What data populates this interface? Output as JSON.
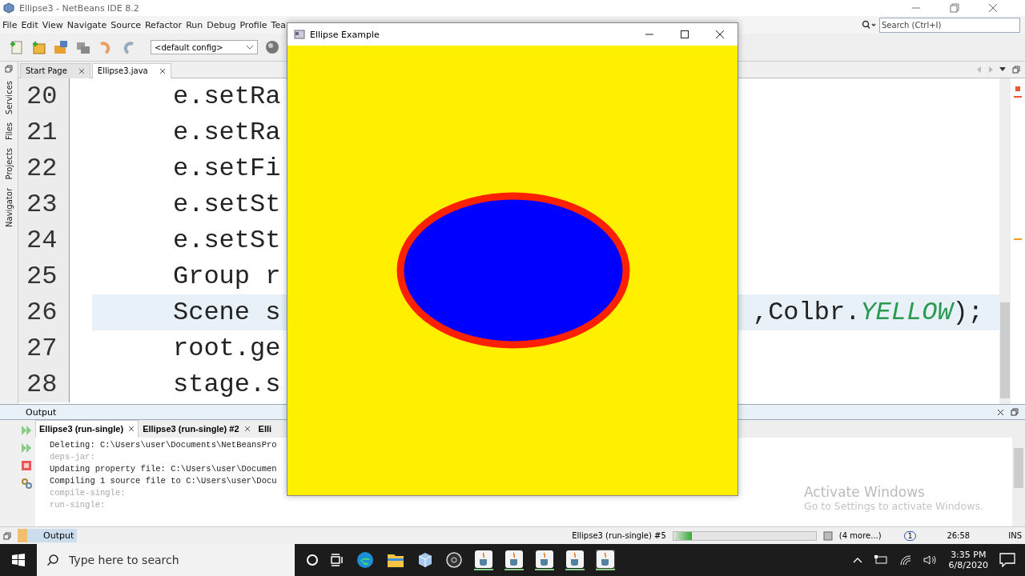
{
  "ide": {
    "title": "Ellipse3 - NetBeans IDE 8.2",
    "menu": [
      "File",
      "Edit",
      "View",
      "Navigate",
      "Source",
      "Refactor",
      "Run",
      "Debug",
      "Profile",
      "Tea"
    ],
    "config": "<default config>",
    "search": {
      "placeholder": "Search (Ctrl+I)"
    }
  },
  "side_tabs": [
    "Services",
    "Files",
    "Projects",
    "Navigator"
  ],
  "editor_tabs": [
    {
      "label": "Start Page",
      "selected": false
    },
    {
      "label": "Ellipse3.java",
      "selected": true
    }
  ],
  "code_lines": [
    {
      "number": "20",
      "text": "e.setRa",
      "current": false
    },
    {
      "number": "21",
      "text": "e.setRa",
      "current": false
    },
    {
      "number": "22",
      "text": "e.setFi",
      "current": false
    },
    {
      "number": "23",
      "text": "e.setSt",
      "current": false
    },
    {
      "number": "24",
      "text": "e.setSt",
      "current": false
    },
    {
      "number": "25",
      "text": "Group r",
      "current": false
    },
    {
      "number": "26",
      "text": "Scene s",
      "right": ",Colbr.",
      "constant": "YELLOW",
      "end": ");",
      "current": true
    },
    {
      "number": "27",
      "text": "root.ge",
      "current": false
    },
    {
      "number": "28",
      "text": "stage.s",
      "current": false
    }
  ],
  "output": {
    "title": "Output",
    "tabs": [
      {
        "label": "Ellipse3 (run-single)",
        "selected": true
      },
      {
        "label": "Ellipse3 (run-single) #2",
        "selected": false
      },
      {
        "label": "Elli",
        "selected": false
      }
    ],
    "lines": [
      {
        "text": "Deleting: C:\\Users\\user\\Documents\\NetBeansPro",
        "kind": "message"
      },
      {
        "text": "deps-jar:",
        "kind": "target"
      },
      {
        "text": "Updating property file: C:\\Users\\user\\Documen",
        "kind": "message"
      },
      {
        "text": "Compiling 1 source file to C:\\Users\\user\\Docu",
        "kind": "message"
      },
      {
        "text": "compile-single:",
        "kind": "target"
      },
      {
        "text": "run-single:",
        "kind": "target"
      }
    ]
  },
  "activation": {
    "title": "Activate Windows",
    "text": "Go to Settings to activate Windows."
  },
  "bottom_tab": "Output",
  "status_bar": {
    "task": "Ellipse3 (run-single) #5",
    "level": 0.13,
    "more": "(4 more...)",
    "notifications": "1",
    "position": "26:58",
    "mode": "INS"
  },
  "app_window": {
    "title": "Ellipse Example"
  },
  "taskbar": {
    "search": {
      "placeholder": "Type here to search"
    },
    "time": "3:35 PM",
    "date": "6/8/2020"
  }
}
